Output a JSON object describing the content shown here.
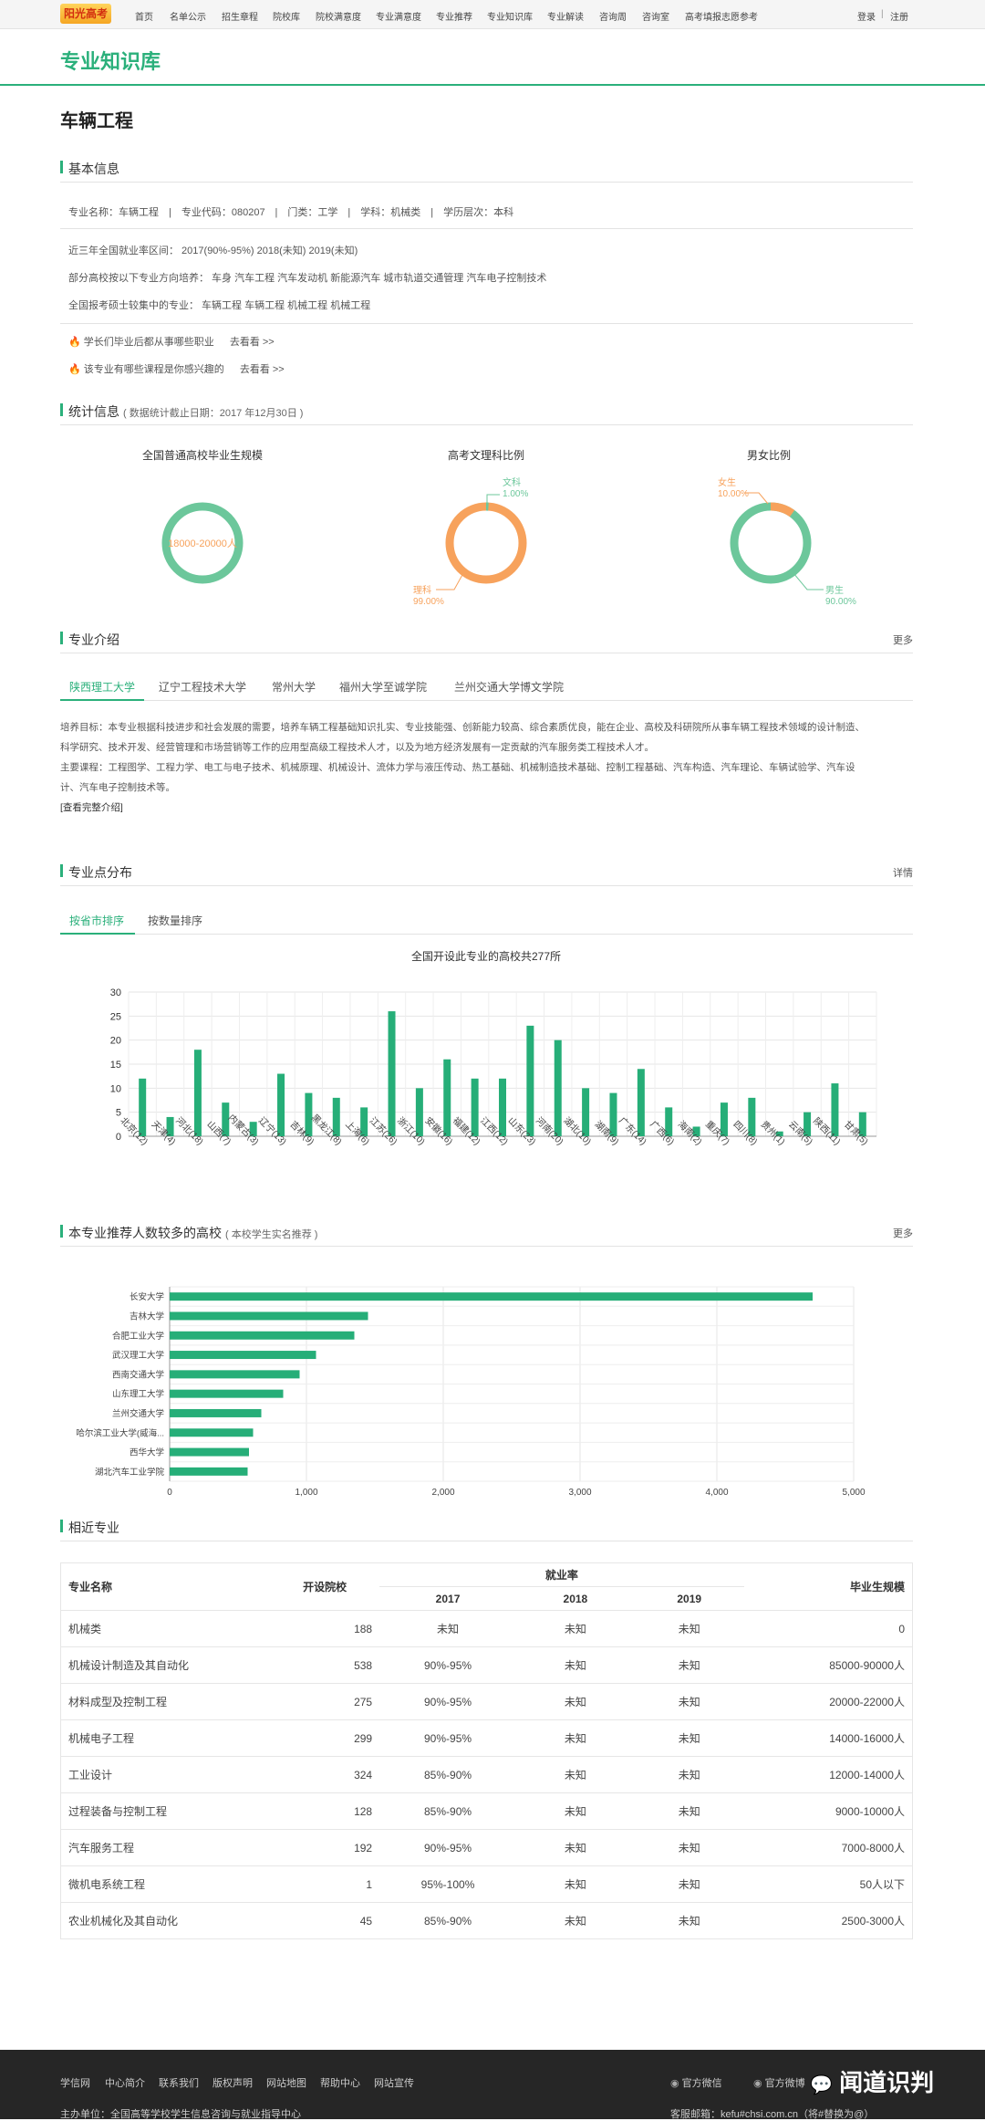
{
  "nav": {
    "logo": "阳光高考",
    "links": [
      "首页",
      "名单公示",
      "招生章程",
      "院校库",
      "院校满意度",
      "专业满意度",
      "专业推荐",
      "专业知识库",
      "专业解读",
      "咨询周",
      "咨询室",
      "高考填报志愿参考"
    ],
    "login": "登录",
    "register": "注册"
  },
  "header": {
    "title": "专业知识库"
  },
  "major": {
    "name": "车辆工程"
  },
  "basic": {
    "title": "基本信息",
    "line1": "专业名称：车辆工程　|　专业代码：080207　|　门类：工学　|　学科：机械类　|　学历层次：本科",
    "line2": "近三年全国就业率区间：  2017(90%-95%)    2018(未知)    2019(未知)",
    "line3": "部分高校按以下专业方向培养：  车身   汽车工程   汽车发动机   新能源汽车   城市轨道交通管理   汽车电子控制技术",
    "line4": "全国报考硕士较集中的专业：  车辆工程   车辆工程   机械工程   机械工程",
    "tip1": "学长们毕业后都从事哪些职业",
    "tip2": "该专业有哪些课程是你感兴趣的",
    "go": "去看看 >>"
  },
  "stats": {
    "title": "统计信息",
    "sub": "( 数据统计截止日期：2017 年12月30日 )",
    "d1": {
      "title": "全国普通高校毕业生规模",
      "center": "18000-20000人"
    },
    "d2": {
      "title": "高考文理科比例",
      "a_label": "文科",
      "a_val": "1.00%",
      "b_label": "理科",
      "b_val": "99.00%",
      "a": 1,
      "b": 99
    },
    "d3": {
      "title": "男女比例",
      "a_label": "女生",
      "a_val": "10.00%",
      "b_label": "男生",
      "b_val": "90.00%",
      "a": 10,
      "b": 90
    },
    "colors": {
      "green": "#6cc79b",
      "orange": "#f7a25c"
    }
  },
  "intro": {
    "title": "专业介绍",
    "more": "更多",
    "tabs": [
      "陕西理工大学",
      "辽宁工程技术大学",
      "常州大学",
      "福州大学至诚学院",
      "兰州交通大学博文学院"
    ],
    "p1": "培养目标：本专业根据科技进步和社会发展的需要，培养车辆工程基础知识扎实、专业技能强、创新能力较高、综合素质优良，能在企业、高校及科研院所从事车辆工程技术领域的设计制造、",
    "p2": "科学研究、技术开发、经营管理和市场营销等工作的应用型高级工程技术人才，以及为地方经济发展有一定贡献的汽车服务类工程技术人才。",
    "p3": "主要课程：工程图学、工程力学、电工与电子技术、机械原理、机械设计、流体力学与液压传动、热工基础、机械制造技术基础、控制工程基础、汽车构造、汽车理论、车辆试验学、汽车设",
    "p4": "计、汽车电子控制技术等。",
    "link": "[查看完整介绍]"
  },
  "dist": {
    "title": "专业点分布",
    "more": "详情",
    "tabs": [
      "按省市排序",
      "按数量排序"
    ],
    "chart_title": "全国开设此专业的高校共277所"
  },
  "rec": {
    "title": "本专业推荐人数较多的高校",
    "sub": "( 本校学生实名推荐 )",
    "more": "更多"
  },
  "chart_data": [
    {
      "type": "bar",
      "title": "全国开设此专业的高校共277所",
      "categories": [
        "北京(12)",
        "天津(4)",
        "河北(18)",
        "山西(7)",
        "内蒙古(3)",
        "辽宁(13)",
        "吉林(9)",
        "黑龙江(8)",
        "上海(6)",
        "江苏(26)",
        "浙江(10)",
        "安徽(16)",
        "福建(12)",
        "江西(12)",
        "山东(23)",
        "河南(20)",
        "湖北(10)",
        "湖南(9)",
        "广东(14)",
        "广西(6)",
        "海南(2)",
        "重庆(7)",
        "四川(8)",
        "贵州(1)",
        "云南(5)",
        "陕西(11)",
        "甘肃(5)"
      ],
      "values": [
        12,
        4,
        18,
        7,
        3,
        13,
        9,
        8,
        6,
        26,
        10,
        16,
        12,
        12,
        23,
        20,
        10,
        9,
        14,
        6,
        2,
        7,
        8,
        1,
        5,
        11,
        5
      ],
      "ylim": [
        0,
        30
      ],
      "yticks": [
        0,
        5,
        10,
        15,
        20,
        25,
        30
      ],
      "color": "#26ae78"
    },
    {
      "type": "bar",
      "orientation": "horizontal",
      "categories": [
        "长安大学",
        "吉林大学",
        "合肥工业大学",
        "武汉理工大学",
        "西南交通大学",
        "山东理工大学",
        "兰州交通大学",
        "哈尔滨工业大学(威海...",
        "西华大学",
        "湖北汽车工业学院"
      ],
      "values": [
        4700,
        1450,
        1350,
        1070,
        950,
        830,
        670,
        610,
        580,
        570
      ],
      "xlim": [
        0,
        5000
      ],
      "xticks": [
        "0",
        "1,000",
        "2,000",
        "3,000",
        "4,000",
        "5,000"
      ],
      "color": "#26ae78"
    }
  ],
  "related": {
    "title": "相近专业",
    "headers": {
      "name": "专业名称",
      "count": "开设院校",
      "emp": "就业率",
      "y1": "2017",
      "y2": "2018",
      "y3": "2019",
      "scale": "毕业生规模"
    },
    "rows": [
      [
        "机械类",
        "188",
        "未知",
        "未知",
        "未知",
        "0"
      ],
      [
        "机械设计制造及其自动化",
        "538",
        "90%-95%",
        "未知",
        "未知",
        "85000-90000人"
      ],
      [
        "材料成型及控制工程",
        "275",
        "90%-95%",
        "未知",
        "未知",
        "20000-22000人"
      ],
      [
        "机械电子工程",
        "299",
        "90%-95%",
        "未知",
        "未知",
        "14000-16000人"
      ],
      [
        "工业设计",
        "324",
        "85%-90%",
        "未知",
        "未知",
        "12000-14000人"
      ],
      [
        "过程装备与控制工程",
        "128",
        "85%-90%",
        "未知",
        "未知",
        "9000-10000人"
      ],
      [
        "汽车服务工程",
        "192",
        "90%-95%",
        "未知",
        "未知",
        "7000-8000人"
      ],
      [
        "微机电系统工程",
        "1",
        "95%-100%",
        "未知",
        "未知",
        "50人以下"
      ],
      [
        "农业机械化及其自动化",
        "45",
        "85%-90%",
        "未知",
        "未知",
        "2500-3000人"
      ]
    ]
  },
  "footer": {
    "links": [
      "学信网",
      "中心简介",
      "联系我们",
      "版权声明",
      "网站地图",
      "帮助中心",
      "网站宣传"
    ],
    "wechat": "官方微信",
    "weibo": "官方微博",
    "brand": "闻道识判",
    "sponsor": "主办单位：全国高等学校学生信息咨询与就业指导中心",
    "email": "客服邮箱：kefu#chsi.com.cn（将#替换为@）"
  }
}
